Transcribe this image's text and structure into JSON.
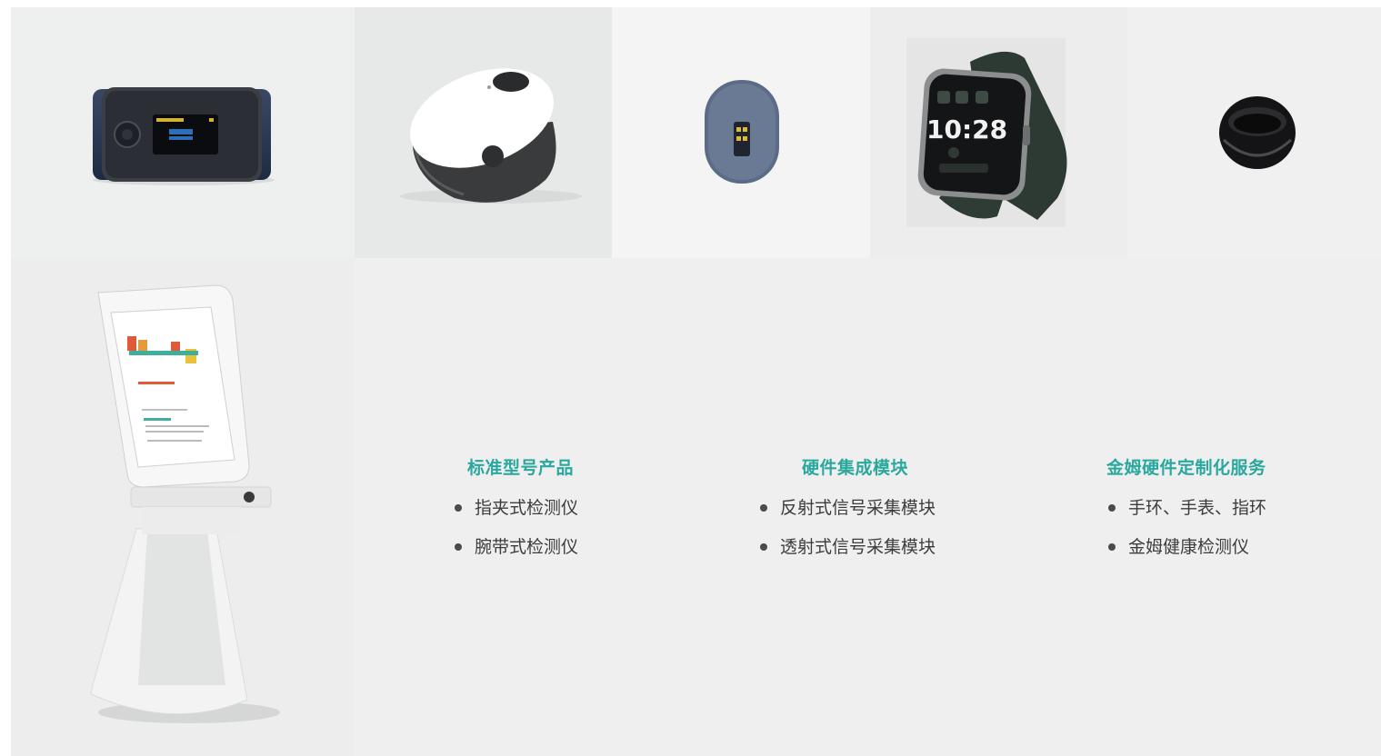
{
  "products": [
    {
      "name": "finger-clip-device"
    },
    {
      "name": "white-pebble-device"
    },
    {
      "name": "sensor-module"
    },
    {
      "name": "smart-watch",
      "watch_time": "10:28"
    },
    {
      "name": "smart-ring"
    },
    {
      "name": "health-kiosk"
    }
  ],
  "columns": [
    {
      "title": "标准型号产品",
      "items": [
        "指夹式检测仪",
        "腕带式检测仪"
      ]
    },
    {
      "title": "硬件集成模块",
      "items": [
        "反射式信号采集模块",
        "透射式信号采集模块"
      ]
    },
    {
      "title": "金姆硬件定制化服务",
      "items": [
        "手环、手表、指环",
        "金姆健康检测仪"
      ]
    }
  ],
  "colors": {
    "accent": "#2aa89d",
    "text": "#3c3c3c",
    "bullet": "#4a4a4a"
  }
}
